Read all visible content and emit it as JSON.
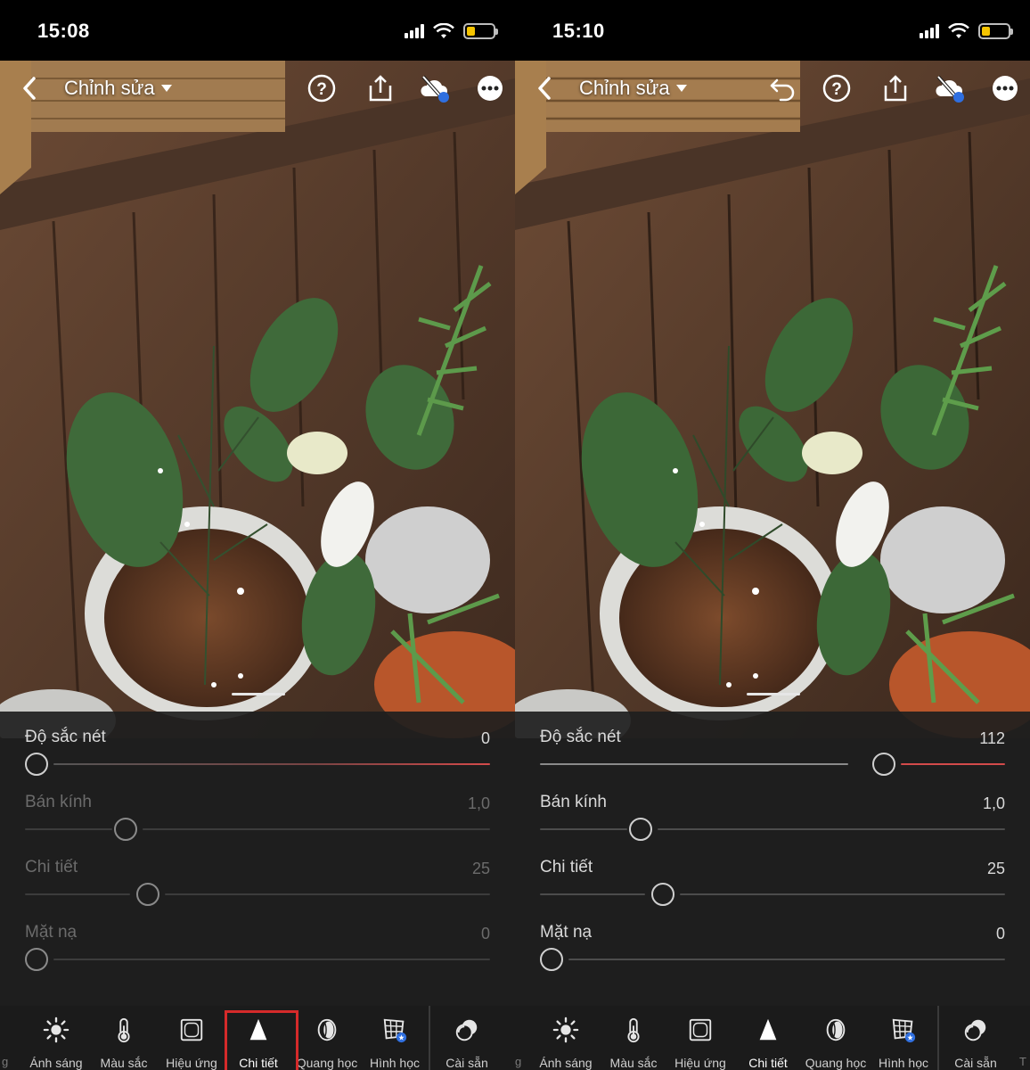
{
  "screens": [
    {
      "id": "before",
      "status": {
        "time": "15:08"
      },
      "header": {
        "title": "Chỉnh sửa"
      },
      "sliders": [
        {
          "label": "Độ sắc nét",
          "value": "0",
          "level": 0.0,
          "dimmed": false
        },
        {
          "label": "Bán kính",
          "value": "1,0",
          "level": 0.2,
          "dimmed": true
        },
        {
          "label": "Chi tiết",
          "value": "25",
          "level": 0.25,
          "dimmed": true
        },
        {
          "label": "Mặt nạ",
          "value": "0",
          "level": 0.0,
          "dimmed": true
        }
      ],
      "tabs": [
        {
          "label": "Ánh sáng",
          "icon": "sun-icon"
        },
        {
          "label": "Màu sắc",
          "icon": "thermometer-icon"
        },
        {
          "label": "Hiệu ứng",
          "icon": "vignette-icon"
        },
        {
          "label": "Chi tiết",
          "icon": "triangle-icon",
          "active": true
        },
        {
          "label": "Quang học",
          "icon": "lens-icon"
        },
        {
          "label": "Hình học",
          "icon": "grid-icon"
        },
        {
          "label": "Cài sẵn",
          "icon": "presets-icon"
        }
      ],
      "edge_left": "g",
      "edge_right": ""
    },
    {
      "id": "after",
      "status": {
        "time": "15:10"
      },
      "header": {
        "title": "Chỉnh sửa"
      },
      "sliders": [
        {
          "label": "Độ sắc nét",
          "value": "112",
          "level": 0.74,
          "dimmed": false
        },
        {
          "label": "Bán kính",
          "value": "1,0",
          "level": 0.2,
          "dimmed": false
        },
        {
          "label": "Chi tiết",
          "value": "25",
          "level": 0.25,
          "dimmed": false
        },
        {
          "label": "Mặt nạ",
          "value": "0",
          "level": 0.0,
          "dimmed": false
        }
      ],
      "tabs": [
        {
          "label": "Ánh sáng",
          "icon": "sun-icon"
        },
        {
          "label": "Màu sắc",
          "icon": "thermometer-icon"
        },
        {
          "label": "Hiệu ứng",
          "icon": "vignette-icon"
        },
        {
          "label": "Chi tiết",
          "icon": "triangle-icon",
          "active": true
        },
        {
          "label": "Quang học",
          "icon": "lens-icon"
        },
        {
          "label": "Hình học",
          "icon": "grid-icon"
        },
        {
          "label": "Cài sẵn",
          "icon": "presets-icon"
        }
      ],
      "edge_left": "g",
      "edge_right": "T"
    }
  ],
  "colors": {
    "accent_red": "#d34a4a",
    "highlight_box": "#d52a2a",
    "sync_dot": "#2f6fe0"
  }
}
